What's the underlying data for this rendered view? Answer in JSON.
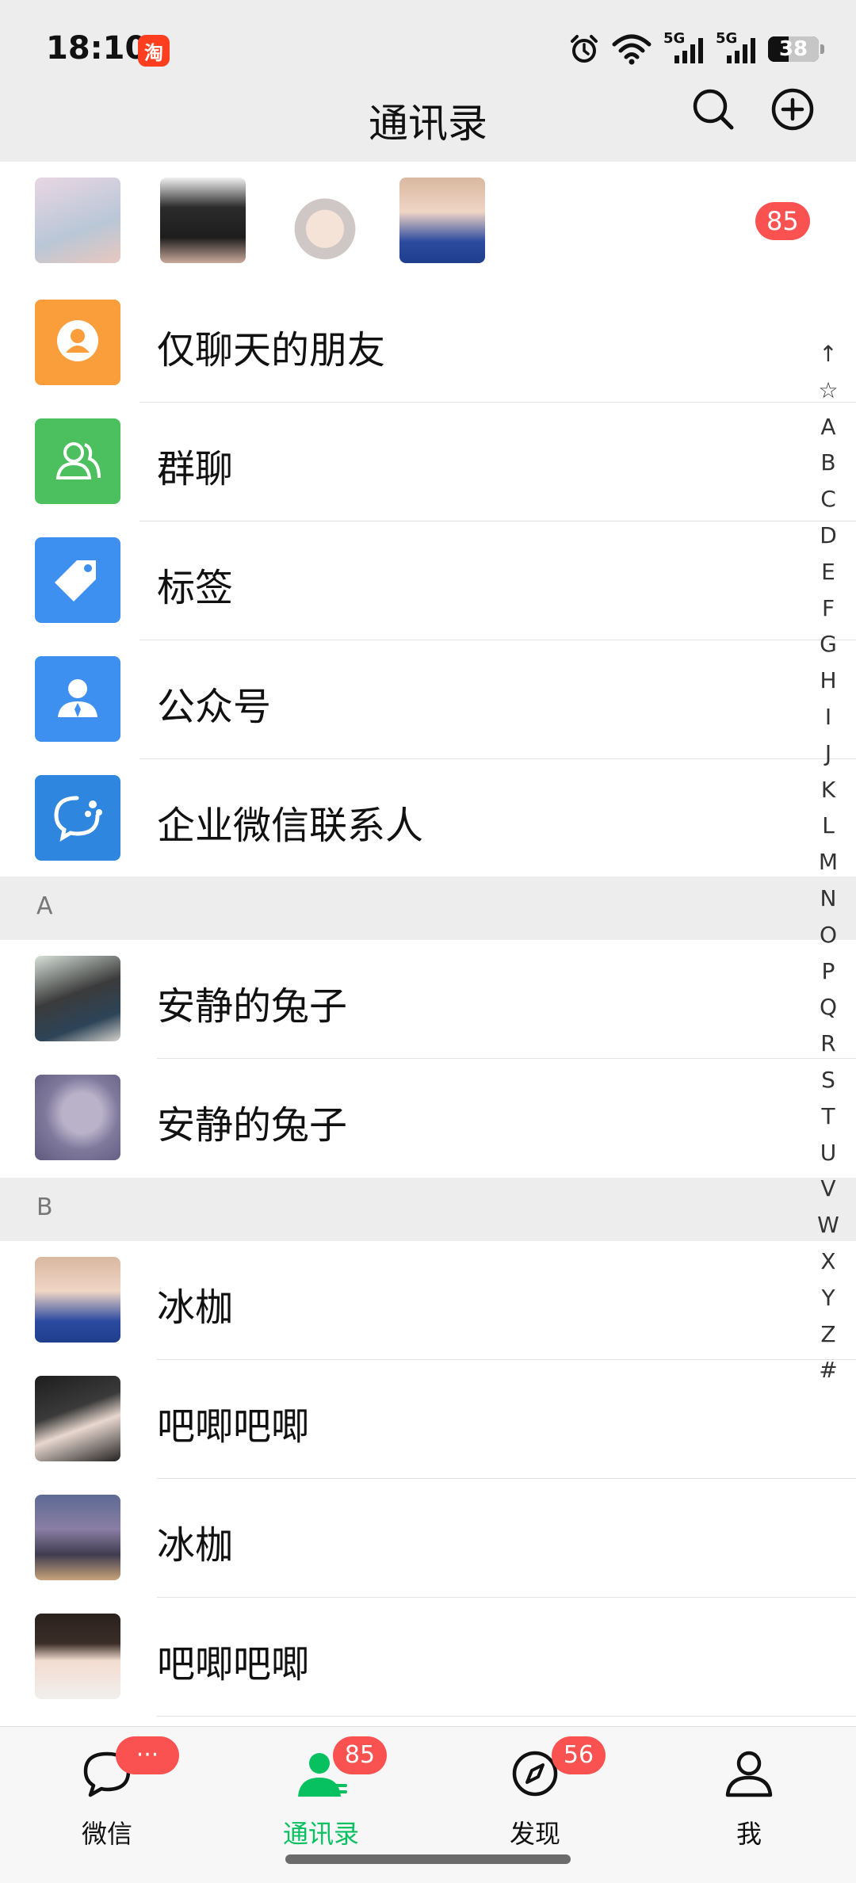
{
  "status": {
    "time": "18:10",
    "taobao_badge_text": "淘",
    "signal1": "5G",
    "signal2": "5G",
    "battery": "38"
  },
  "header": {
    "title": "通讯录"
  },
  "requests": {
    "badge": "85"
  },
  "features": [
    {
      "label": "仅聊天的朋友",
      "icon": "chat-only-friends-icon",
      "color": "#fa9d3b"
    },
    {
      "label": "群聊",
      "icon": "group-chat-icon",
      "color": "#4cc05f"
    },
    {
      "label": "标签",
      "icon": "tag-icon",
      "color": "#3d8ff0"
    },
    {
      "label": "公众号",
      "icon": "official-account-icon",
      "color": "#3d8ff0"
    },
    {
      "label": "企业微信联系人",
      "icon": "wecom-contact-icon",
      "color": "#2e86de"
    }
  ],
  "sections": [
    {
      "letter": "A",
      "contacts": [
        "安静的兔子",
        "安静的兔子"
      ]
    },
    {
      "letter": "B",
      "contacts": [
        "冰枷",
        "吧唧吧唧",
        "冰枷",
        "吧唧吧唧"
      ]
    }
  ],
  "index": [
    "↑",
    "☆",
    "A",
    "B",
    "C",
    "D",
    "E",
    "F",
    "G",
    "H",
    "I",
    "J",
    "K",
    "L",
    "M",
    "N",
    "O",
    "P",
    "Q",
    "R",
    "S",
    "T",
    "U",
    "V",
    "W",
    "X",
    "Y",
    "Z",
    "#"
  ],
  "tabs": [
    {
      "label": "微信",
      "badge": "···",
      "icon": "chat-bubble-icon"
    },
    {
      "label": "通讯录",
      "badge": "85",
      "icon": "contacts-icon"
    },
    {
      "label": "发现",
      "badge": "56",
      "icon": "compass-icon"
    },
    {
      "label": "我",
      "badge": "",
      "icon": "person-icon"
    }
  ],
  "colors": {
    "accent": "#07c160",
    "badge": "#fa5151",
    "header_bg": "#ededed"
  }
}
